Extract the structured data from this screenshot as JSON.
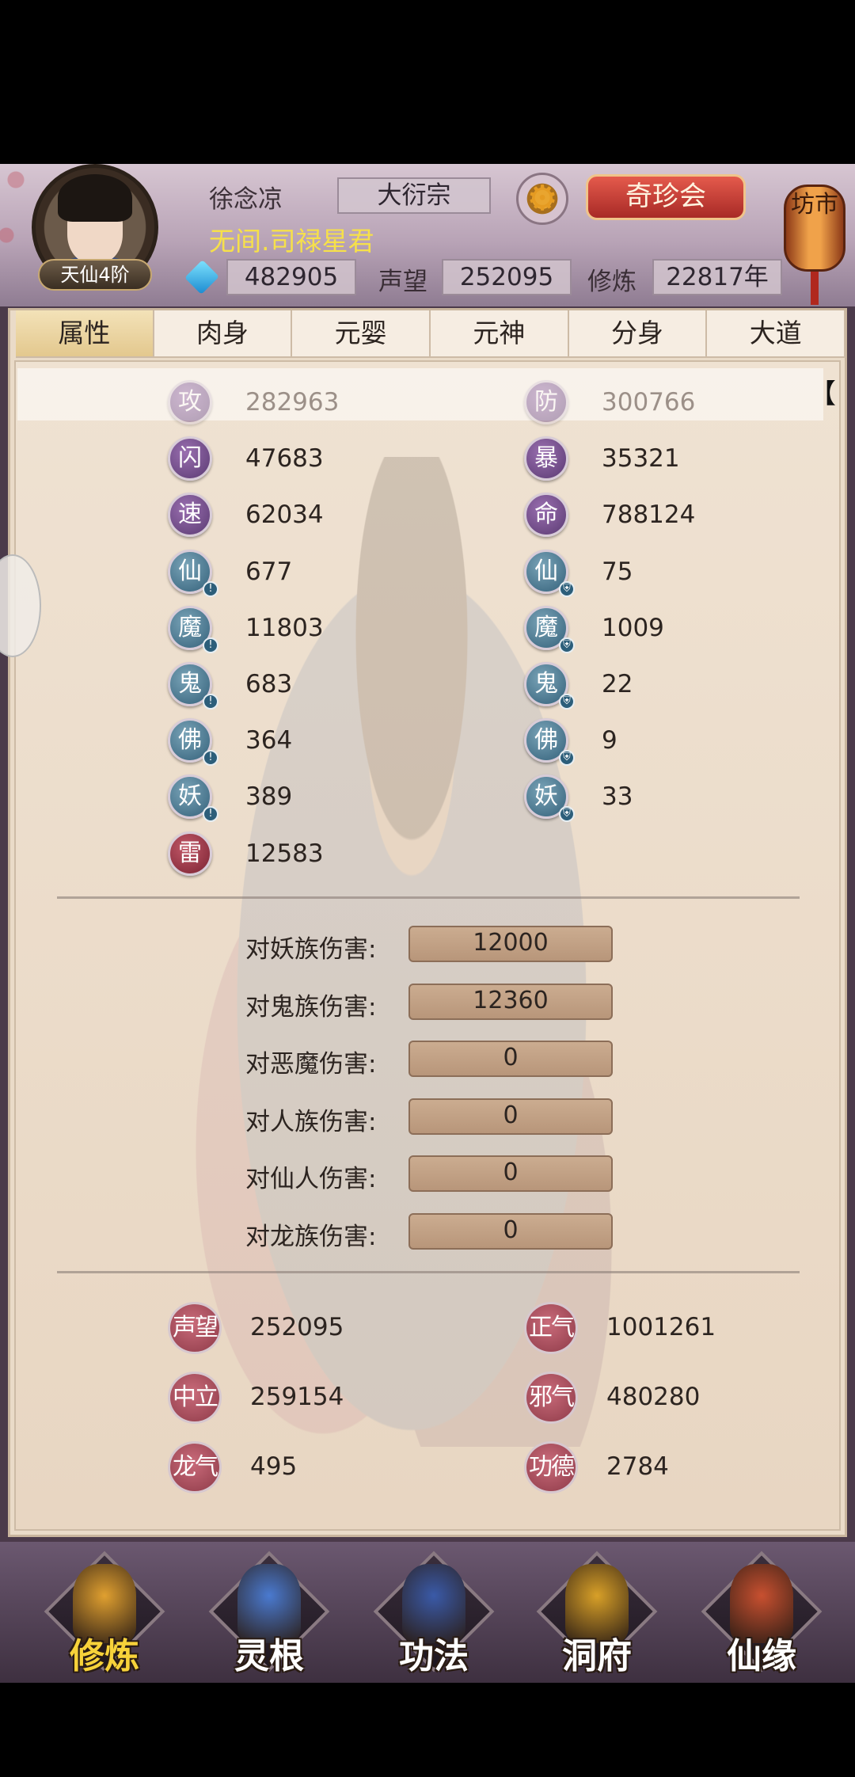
{
  "header": {
    "player_name": "徐念凉",
    "sect": "大衍宗",
    "title": "无间.司禄星君",
    "rank": "天仙4阶",
    "treasure_button": "奇珍会",
    "gems": "482905",
    "reputation_label": "声望",
    "reputation": "252095",
    "cultivation_label": "修炼",
    "cultivation": "22817年",
    "market_label": "坊市"
  },
  "tabs": [
    "属性",
    "肉身",
    "元婴",
    "元神",
    "分身",
    "大道"
  ],
  "active_tab": "属性",
  "attributes": {
    "left": [
      {
        "icon": "攻",
        "value": "282963",
        "color": "purple"
      },
      {
        "icon": "闪",
        "value": "47683",
        "color": "purple"
      },
      {
        "icon": "速",
        "value": "62034",
        "color": "purple"
      },
      {
        "icon": "仙",
        "value": "677",
        "color": "teal"
      },
      {
        "icon": "魔",
        "value": "11803",
        "color": "teal"
      },
      {
        "icon": "鬼",
        "value": "683",
        "color": "teal"
      },
      {
        "icon": "佛",
        "value": "364",
        "color": "teal"
      },
      {
        "icon": "妖",
        "value": "389",
        "color": "teal"
      },
      {
        "icon": "雷",
        "value": "12583",
        "color": "red"
      }
    ],
    "right": [
      {
        "icon": "防",
        "value": "300766",
        "color": "purple"
      },
      {
        "icon": "暴",
        "value": "35321",
        "color": "purple"
      },
      {
        "icon": "命",
        "value": "788124",
        "color": "purple"
      },
      {
        "icon": "仙",
        "value": "75",
        "color": "teal"
      },
      {
        "icon": "魔",
        "value": "1009",
        "color": "teal"
      },
      {
        "icon": "鬼",
        "value": "22",
        "color": "teal"
      },
      {
        "icon": "佛",
        "value": "9",
        "color": "teal"
      },
      {
        "icon": "妖",
        "value": "33",
        "color": "teal"
      }
    ],
    "bracket": "【"
  },
  "damage": [
    {
      "label": "对妖族伤害:",
      "value": "12000"
    },
    {
      "label": "对鬼族伤害:",
      "value": "12360"
    },
    {
      "label": "对恶魔伤害:",
      "value": "0"
    },
    {
      "label": "对人族伤害:",
      "value": "0"
    },
    {
      "label": "对仙人伤害:",
      "value": "0"
    },
    {
      "label": "对龙族伤害:",
      "value": "0"
    }
  ],
  "misc": [
    {
      "label": "声望",
      "value": "252095"
    },
    {
      "label": "正气",
      "value": "1001261"
    },
    {
      "label": "中立",
      "value": "259154"
    },
    {
      "label": "邪气",
      "value": "480280"
    },
    {
      "label": "龙气",
      "value": "495"
    },
    {
      "label": "功德",
      "value": "2784"
    }
  ],
  "nav": [
    {
      "label": "修炼",
      "icon": "meditating-monk-icon",
      "color": "#e0a030"
    },
    {
      "label": "灵根",
      "icon": "yin-yang-sword-icon",
      "color": "#4a7ad0"
    },
    {
      "label": "功法",
      "icon": "scripture-book-icon",
      "color": "#3a5aa8"
    },
    {
      "label": "洞府",
      "icon": "pagoda-icon",
      "color": "#d8a028"
    },
    {
      "label": "仙缘",
      "icon": "gourd-icon",
      "color": "#c85030"
    }
  ]
}
